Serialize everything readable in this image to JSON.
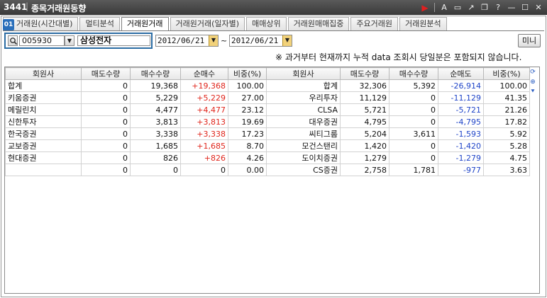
{
  "window": {
    "code": "3441",
    "title": "종목거래원동향"
  },
  "titlebar_icons": [
    "play-icon",
    "font-icon",
    "expand-icon",
    "export-icon",
    "restore-icon",
    "help-icon",
    "minimize-icon",
    "maximize-icon",
    "close-icon"
  ],
  "tabs": [
    {
      "label": "거래원(시간대별)",
      "active": false
    },
    {
      "label": "멀티분석",
      "active": false
    },
    {
      "label": "거래원거래",
      "active": true
    },
    {
      "label": "거래원거래(일자별)",
      "active": false
    },
    {
      "label": "매매상위",
      "active": false
    },
    {
      "label": "거래원매매집중",
      "active": false
    },
    {
      "label": "주요거래원",
      "active": false
    },
    {
      "label": "거래원분석",
      "active": false
    }
  ],
  "tab_badge": "01",
  "controls": {
    "stock_code": "005930",
    "stock_name": "삼성전자",
    "date_from": "2012/06/21",
    "date_to": "2012/06/21",
    "range_sep": "~",
    "mini_button": "미니"
  },
  "note": "※ 과거부터 현재까지 누적 data 조회시 당일분은 포함되지 않습니다.",
  "table": {
    "headers": [
      "회원사",
      "매도수량",
      "매수수량",
      "순매수",
      "비중(%)",
      "회원사",
      "매도수량",
      "매수수량",
      "순매도",
      "비중(%)"
    ],
    "rows": [
      [
        "합계",
        "0",
        "19,368",
        "+19,368",
        "100.00",
        "합계",
        "32,306",
        "5,392",
        "-26,914",
        "100.00"
      ],
      [
        "키움증권",
        "0",
        "5,229",
        "+5,229",
        "27.00",
        "우리투자",
        "11,129",
        "0",
        "-11,129",
        "41.35"
      ],
      [
        "메릴린치",
        "0",
        "4,477",
        "+4,477",
        "23.12",
        "CLSA",
        "5,721",
        "0",
        "-5,721",
        "21.26"
      ],
      [
        "신한투자",
        "0",
        "3,813",
        "+3,813",
        "19.69",
        "대우증권",
        "4,795",
        "0",
        "-4,795",
        "17.82"
      ],
      [
        "한국증권",
        "0",
        "3,338",
        "+3,338",
        "17.23",
        "씨티그룹",
        "5,204",
        "3,611",
        "-1,593",
        "5.92"
      ],
      [
        "교보증권",
        "0",
        "1,685",
        "+1,685",
        "8.70",
        "모건스탠리",
        "1,420",
        "0",
        "-1,420",
        "5.28"
      ],
      [
        "현대증권",
        "0",
        "826",
        "+826",
        "4.26",
        "도이치증권",
        "1,279",
        "0",
        "-1,279",
        "4.75"
      ],
      [
        "",
        "0",
        "0",
        "0",
        "0.00",
        "CS증권",
        "2,758",
        "1,781",
        "-977",
        "3.63"
      ]
    ]
  },
  "colors": {
    "plus": "#e0251b",
    "minus": "#2045c8",
    "accent": "#2b6ca3"
  }
}
